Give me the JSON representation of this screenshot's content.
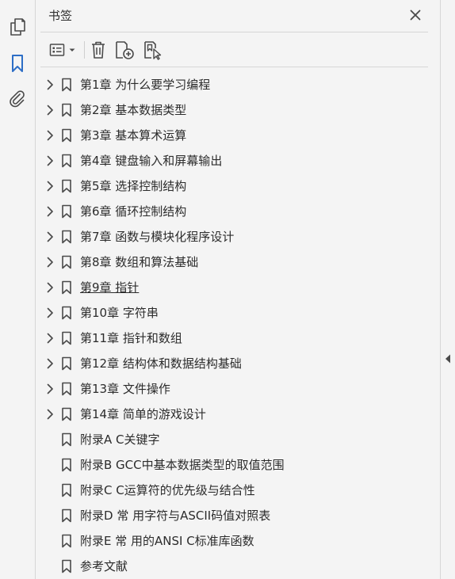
{
  "panel": {
    "title": "书签"
  },
  "rail": {
    "items": [
      {
        "name": "page-thumbnails",
        "icon": "pages-icon",
        "active": false
      },
      {
        "name": "bookmarks",
        "icon": "bookmark-icon",
        "active": true
      },
      {
        "name": "attachments",
        "icon": "paperclip-icon",
        "active": false
      }
    ]
  },
  "toolbar": {
    "buttons": [
      {
        "icon": "options-list-icon",
        "has_dropdown": true
      },
      {
        "icon": "trash-icon"
      },
      {
        "icon": "new-bookmark-icon"
      },
      {
        "icon": "bookmark-from-selection-icon"
      }
    ]
  },
  "bookmarks": [
    {
      "label": "第1章 为什么要学习编程",
      "expandable": true,
      "current": false
    },
    {
      "label": "第2章 基本数据类型",
      "expandable": true,
      "current": false
    },
    {
      "label": "第3章 基本算术运算",
      "expandable": true,
      "current": false
    },
    {
      "label": "第4章 键盘输入和屏幕输出",
      "expandable": true,
      "current": false
    },
    {
      "label": "第5章 选择控制结构",
      "expandable": true,
      "current": false
    },
    {
      "label": "第6章 循环控制结构",
      "expandable": true,
      "current": false
    },
    {
      "label": "第7章 函数与模块化程序设计",
      "expandable": true,
      "current": false
    },
    {
      "label": "第8章 数组和算法基础",
      "expandable": true,
      "current": false
    },
    {
      "label": "第9章 指针",
      "expandable": true,
      "current": true
    },
    {
      "label": "第10章 字符串",
      "expandable": true,
      "current": false
    },
    {
      "label": "第11章 指针和数组",
      "expandable": true,
      "current": false
    },
    {
      "label": "第12章 结构体和数据结构基础",
      "expandable": true,
      "current": false
    },
    {
      "label": "第13章 文件操作",
      "expandable": true,
      "current": false
    },
    {
      "label": "第14章 简单的游戏设计",
      "expandable": true,
      "current": false
    },
    {
      "label": "附录A C关键字",
      "expandable": false,
      "current": false
    },
    {
      "label": "附录B GCC中基本数据类型的取值范围",
      "expandable": false,
      "current": false
    },
    {
      "label": "附录C C运算符的优先级与结合性",
      "expandable": false,
      "current": false
    },
    {
      "label": "附录D 常 用字符与ASCII码值对照表",
      "expandable": false,
      "current": false
    },
    {
      "label": "附录E 常 用的ANSI C标准库函数",
      "expandable": false,
      "current": false
    },
    {
      "label": "参考文献",
      "expandable": false,
      "current": false
    }
  ],
  "colors": {
    "background": "#f4f4f4",
    "icon": "#4a4a4a",
    "accent": "#2d6ec6",
    "text": "#2c2c2c"
  }
}
